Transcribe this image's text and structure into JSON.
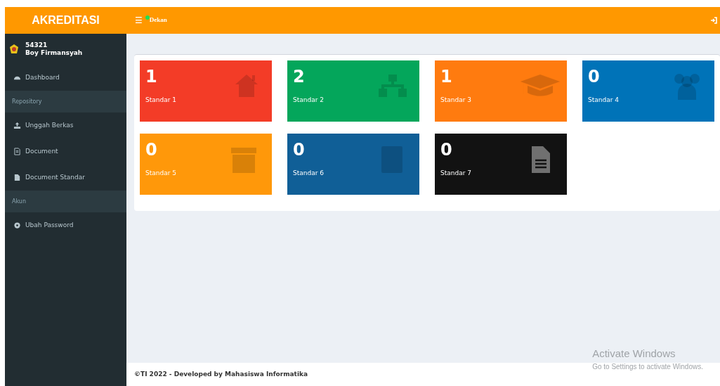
{
  "header": {
    "brand": "AKREDITASI",
    "menu_icon": "☰",
    "user_role": "Dekan"
  },
  "sidebar": {
    "user": {
      "id": "54321",
      "name": "Boy Firmansyah"
    },
    "items": [
      {
        "kind": "link",
        "label": "Dashboard"
      },
      {
        "kind": "header",
        "label": "Repository"
      },
      {
        "kind": "link",
        "label": "Unggah Berkas"
      },
      {
        "kind": "link",
        "label": "Document"
      },
      {
        "kind": "link",
        "label": "Document Standar"
      },
      {
        "kind": "header",
        "label": "Akun"
      },
      {
        "kind": "link",
        "label": "Ubah Password"
      }
    ]
  },
  "boxes": [
    {
      "count": "1",
      "label": "Standar 1",
      "color": "#f33c27"
    },
    {
      "count": "2",
      "label": "Standar 2",
      "color": "#04a65b"
    },
    {
      "count": "1",
      "label": "Standar 3",
      "color": "#ff7b0f"
    },
    {
      "count": "0",
      "label": "Standar 4",
      "color": "#0073b8"
    },
    {
      "count": "0",
      "label": "Standar 5",
      "color": "#ff980a"
    },
    {
      "count": "0",
      "label": "Standar 6",
      "color": "#105f97"
    },
    {
      "count": "0",
      "label": "Standar 7",
      "color": "#121212"
    }
  ],
  "footer": "©TI 2022 - Developed by Mahasiswa Informatika",
  "os_notice": {
    "title": "Activate Windows",
    "subtitle": "Go to Settings to activate Windows."
  }
}
